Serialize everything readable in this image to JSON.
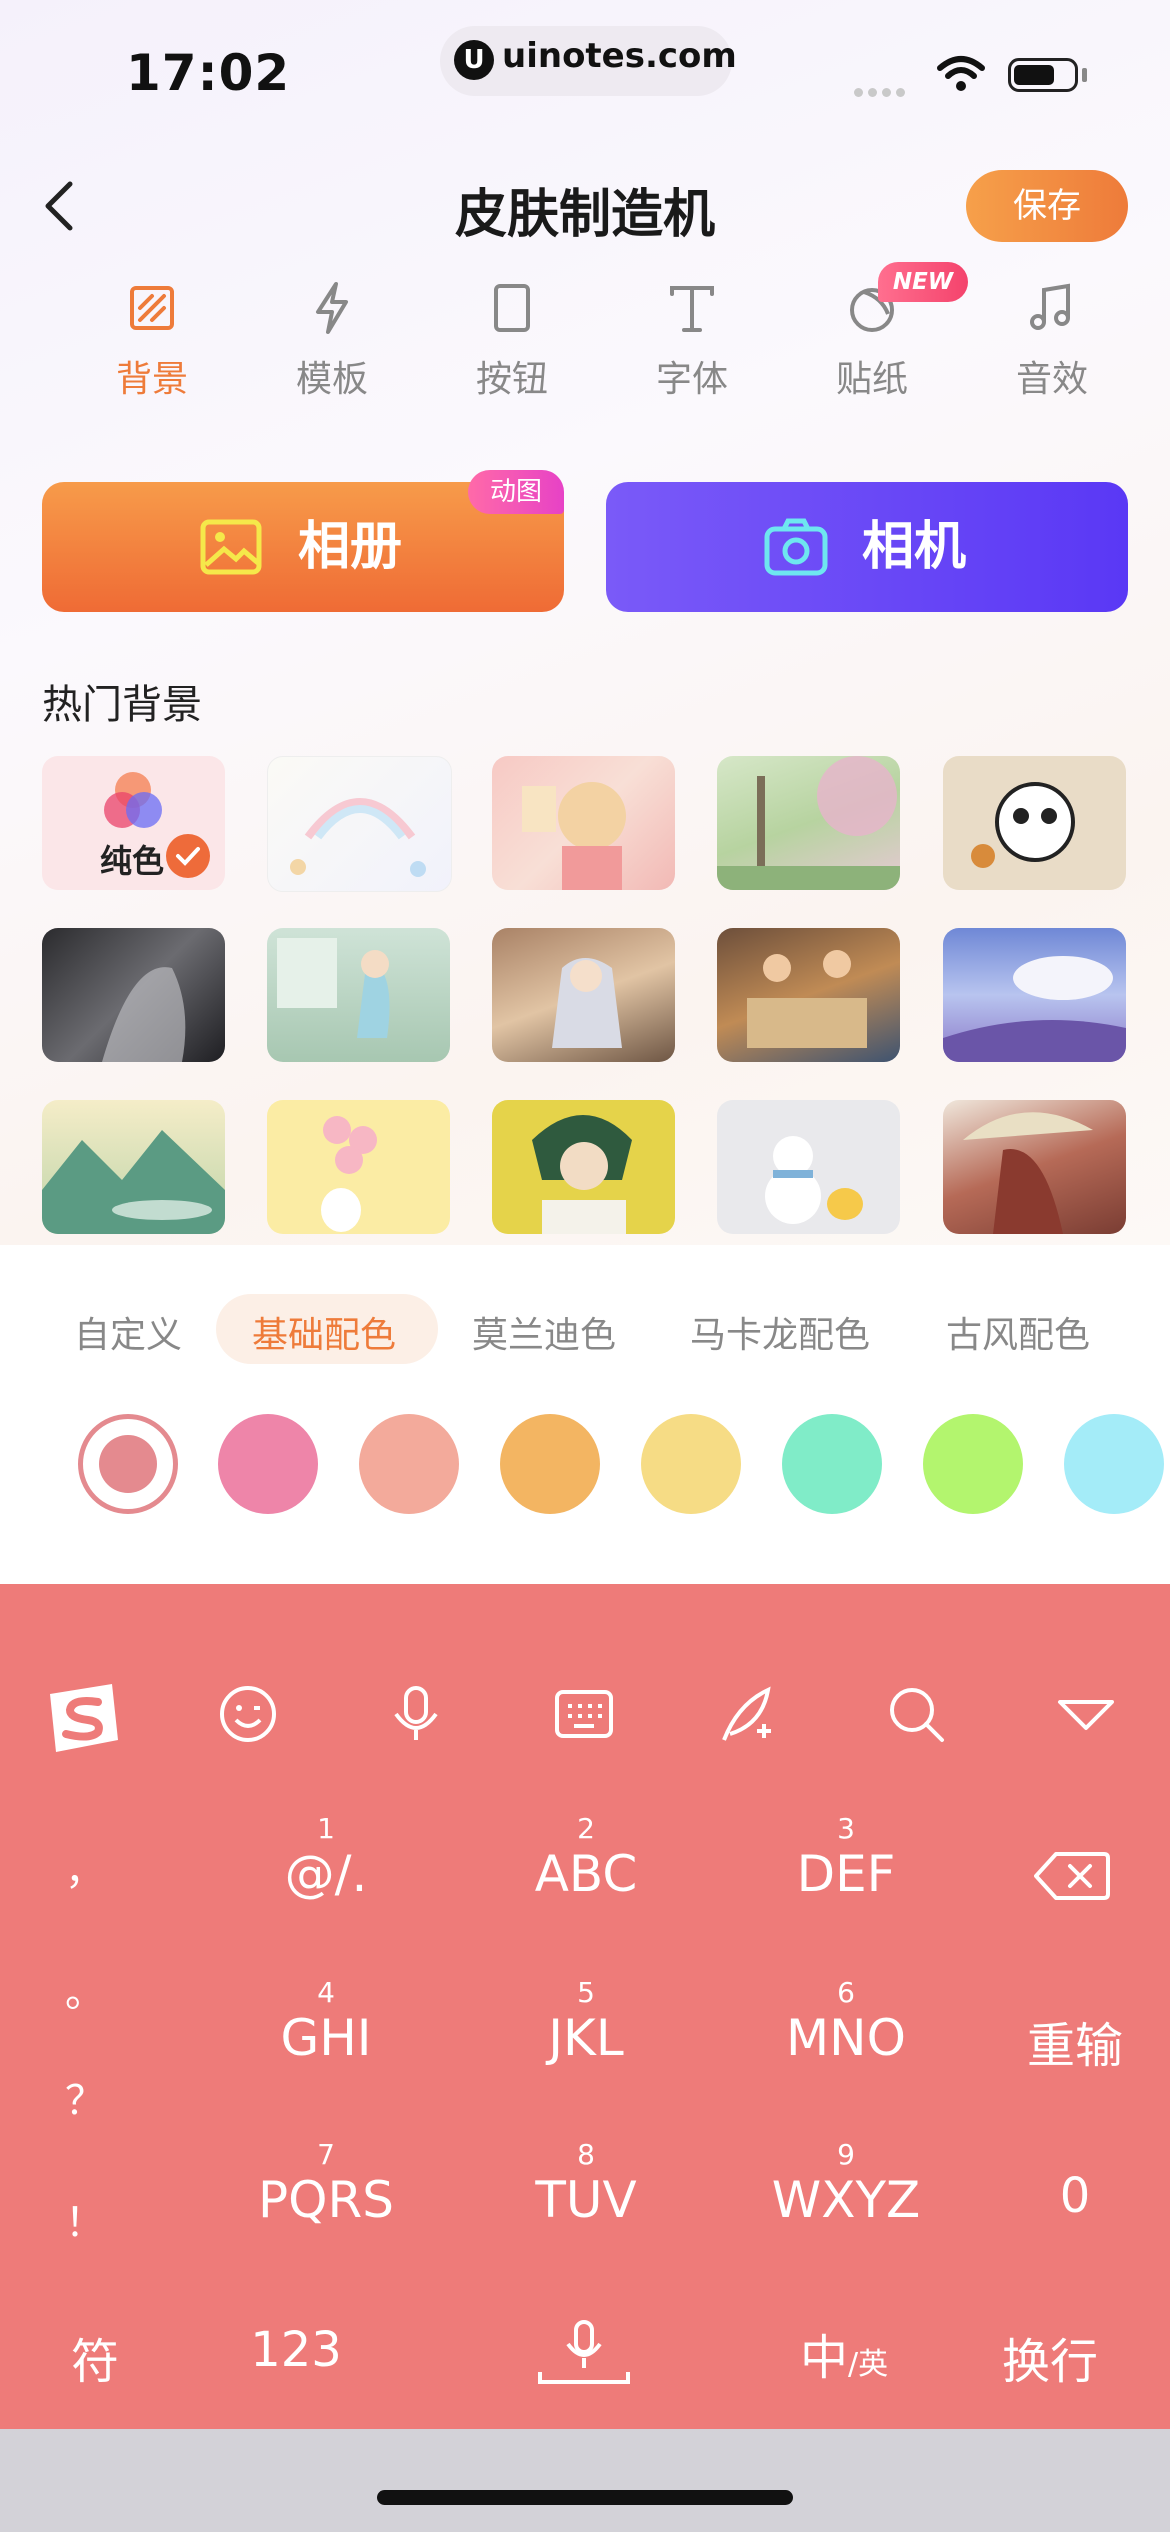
{
  "status_bar": {
    "time": "17:02",
    "url": "uinotes.com",
    "url_logo": "U"
  },
  "header": {
    "title": "皮肤制造机",
    "save_label": "保存"
  },
  "tools": [
    {
      "label": "背景",
      "icon": "background-icon",
      "active": true
    },
    {
      "label": "模板",
      "icon": "lightning-icon"
    },
    {
      "label": "按钮",
      "icon": "button-icon"
    },
    {
      "label": "字体",
      "icon": "font-icon"
    },
    {
      "label": "贴纸",
      "icon": "sticker-icon",
      "badge": "NEW"
    },
    {
      "label": "音效",
      "icon": "music-icon"
    }
  ],
  "actions": {
    "album_label": "相册",
    "album_badge": "动图",
    "camera_label": "相机"
  },
  "hot_backgrounds": {
    "title": "热门背景",
    "solid_label": "纯色",
    "thumbnails": [
      "solid-color",
      "rainbow-cats",
      "anime-girl-pink",
      "cherry-blossom",
      "panda-sticker",
      "dark-fantasy",
      "anime-girl-window",
      "anime-girl-room",
      "boys-table",
      "sky-field",
      "landscape-painting",
      "bunny-balloons",
      "green-hair-boy",
      "snowman-duck",
      "umbrella-girl"
    ]
  },
  "palette": {
    "tabs": [
      "自定义",
      "基础配色",
      "莫兰迪色",
      "马卡龙配色",
      "古风配色"
    ],
    "active_tab": 1,
    "swatches": [
      "#e48a8f",
      "#ee85a9",
      "#f3aa9b",
      "#f3b562",
      "#f6dc85",
      "#80ecc8",
      "#b3f56e",
      "#a4ecf8"
    ],
    "selected_swatch": 0
  },
  "keyboard": {
    "accent": "#ee7b79",
    "toolbar_icons": [
      "sogou-logo-icon",
      "emoji-icon",
      "microphone-icon",
      "keyboard-icon",
      "handwriting-icon",
      "search-icon",
      "collapse-icon"
    ],
    "punct_keys": [
      "，",
      "。",
      "？",
      "！"
    ],
    "keys": [
      {
        "num": "1",
        "letters": "@/."
      },
      {
        "num": "2",
        "letters": "ABC"
      },
      {
        "num": "3",
        "letters": "DEF"
      },
      {
        "num": "4",
        "letters": "GHI"
      },
      {
        "num": "5",
        "letters": "JKL"
      },
      {
        "num": "6",
        "letters": "MNO"
      },
      {
        "num": "7",
        "letters": "PQRS"
      },
      {
        "num": "8",
        "letters": "TUV"
      },
      {
        "num": "9",
        "letters": "WXYZ"
      }
    ],
    "reset_label": "重输",
    "zero_label": "0",
    "symbol_label": "符",
    "num_label": "123",
    "lang_label_main": "中",
    "lang_label_sub": "/英",
    "enter_label": "换行"
  }
}
